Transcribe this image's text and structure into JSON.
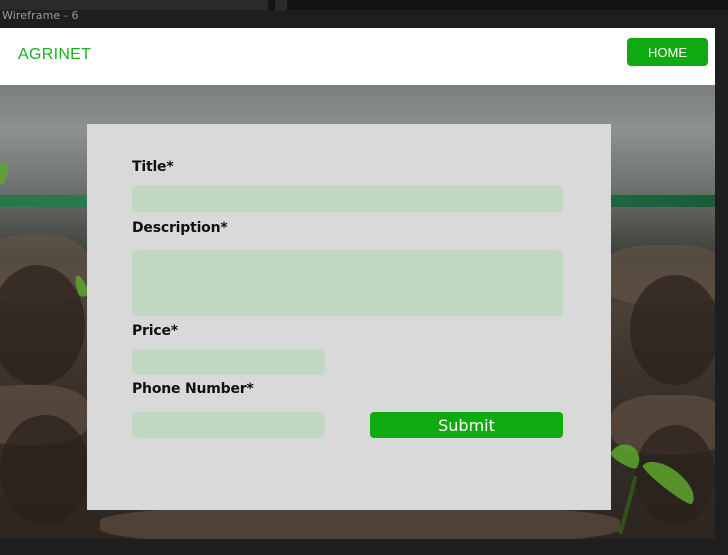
{
  "canvas": {
    "frame_label": "Wireframe - 6"
  },
  "navbar": {
    "logo": "AGRINET",
    "home_label": "HOME"
  },
  "form": {
    "title_label": "Title*",
    "title_value": "",
    "description_label": "Description*",
    "description_value": "",
    "price_label": "Price*",
    "price_value": "",
    "phone_label": "Phone Number*",
    "phone_value": "",
    "submit_label": "Submit"
  },
  "colors": {
    "brand_green": "#17b01e",
    "button_green": "#0faa10",
    "field_fill": "#c2d8c2",
    "card_fill": "#d9d9d9"
  }
}
